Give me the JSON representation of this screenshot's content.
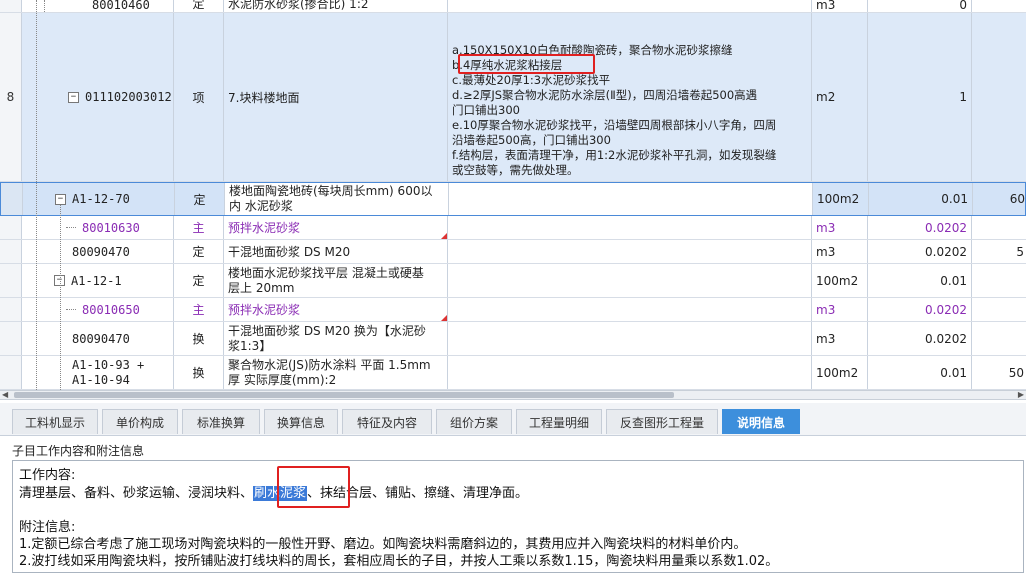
{
  "grid": {
    "rows": [
      {
        "num": "",
        "code": "80010460",
        "type": "定",
        "name": "水泥防水砂浆(掺合比) 1:2",
        "feature": "",
        "unit": "m3",
        "qty": "0",
        "price": ""
      },
      {
        "num": "8",
        "code": "011102003012",
        "type": "项",
        "name": "7.块料楼地面",
        "feature_lines": [
          "a.150X150X10白色耐酸陶瓷砖，聚合物水泥砂浆擦缝",
          "b.4厚纯水泥浆粘接层",
          "c.最薄处20厚1:3水泥砂浆找平",
          "d.≥2厚JS聚合物水泥防水涂层(Ⅱ型)，四周沿墙卷起500高遇",
          "门口铺出300",
          "e.10厚聚合物水泥砂浆找平，沿墙壁四周根部抹小八字角，四周",
          "沿墙卷起500高，门口铺出300",
          "f.结构层，表面清理干净，用1:2水泥砂浆补平孔洞，如发现裂缝",
          "或空鼓等，需先做处理。"
        ],
        "unit": "m2",
        "qty": "1",
        "price": ""
      },
      {
        "num": "",
        "code": "A1-12-70",
        "type": "定",
        "name_lines": [
          "楼地面陶瓷地砖(每块周长mm) 600以",
          "内 水泥砂浆"
        ],
        "feature": "",
        "unit": "100m2",
        "qty": "0.01",
        "price": "60"
      },
      {
        "num": "",
        "code": "80010630",
        "type": "主",
        "name": "预拌水泥砂浆",
        "feature": "",
        "unit": "m3",
        "qty": "0.0202",
        "price": ""
      },
      {
        "num": "",
        "code": "80090470",
        "type": "定",
        "name": "干混地面砂浆 DS M20",
        "feature": "",
        "unit": "m3",
        "qty": "0.0202",
        "price": "5"
      },
      {
        "num": "",
        "code": "A1-12-1",
        "type": "定",
        "name_lines": [
          "楼地面水泥砂浆找平层 混凝土或硬基",
          "层上 20mm"
        ],
        "feature": "",
        "unit": "100m2",
        "qty": "0.01",
        "price": ""
      },
      {
        "num": "",
        "code": "80010650",
        "type": "主",
        "name": "预拌水泥砂浆",
        "feature": "",
        "unit": "m3",
        "qty": "0.0202",
        "price": ""
      },
      {
        "num": "",
        "code": "80090470",
        "type": "换",
        "name_lines": [
          "干混地面砂浆 DS M20  换为【水泥砂",
          "浆1:3】"
        ],
        "feature": "",
        "unit": "m3",
        "qty": "0.0202",
        "price": ""
      },
      {
        "num": "",
        "code_lines": [
          "A1-10-93 +",
          "A1-10-94"
        ],
        "type": "换",
        "name_lines": [
          "聚合物水泥(JS)防水涂料 平面 1.5mm",
          "厚  实际厚度(mm):2"
        ],
        "feature": "",
        "unit": "100m2",
        "qty": "0.01",
        "price": "50"
      }
    ]
  },
  "tabs": [
    "工料机显示",
    "单价构成",
    "标准换算",
    "换算信息",
    "特征及内容",
    "组价方案",
    "工程量明细",
    "反查图形工程量",
    "说明信息"
  ],
  "active_tab": "说明信息",
  "panel": {
    "title": "子目工作内容和附注信息",
    "work_heading": "工作内容:",
    "work_before": "清理基层、备料、砂浆运输、浸润块料、",
    "work_selected": "刷水泥浆",
    "work_after": "、抹结合层、铺贴、擦缝、清理净面。",
    "notes_heading": "附注信息:",
    "notes": [
      "1.定额已综合考虑了施工现场对陶瓷块料的一般性开野、磨边。如陶瓷块料需磨斜边的，其费用应并入陶瓷块料的材料单价内。",
      "2.波打线如采用陶瓷块料，按所铺贴波打线块料的周长，套相应周长的子目，并按人工乘以系数1.15，陶瓷块料用量乘以系数1.02。"
    ]
  },
  "colors": {
    "accent": "#3d8fdc",
    "highlight_row": "#dde9f8",
    "main_material": "#8a2cb4",
    "annotation": "#e02020"
  }
}
